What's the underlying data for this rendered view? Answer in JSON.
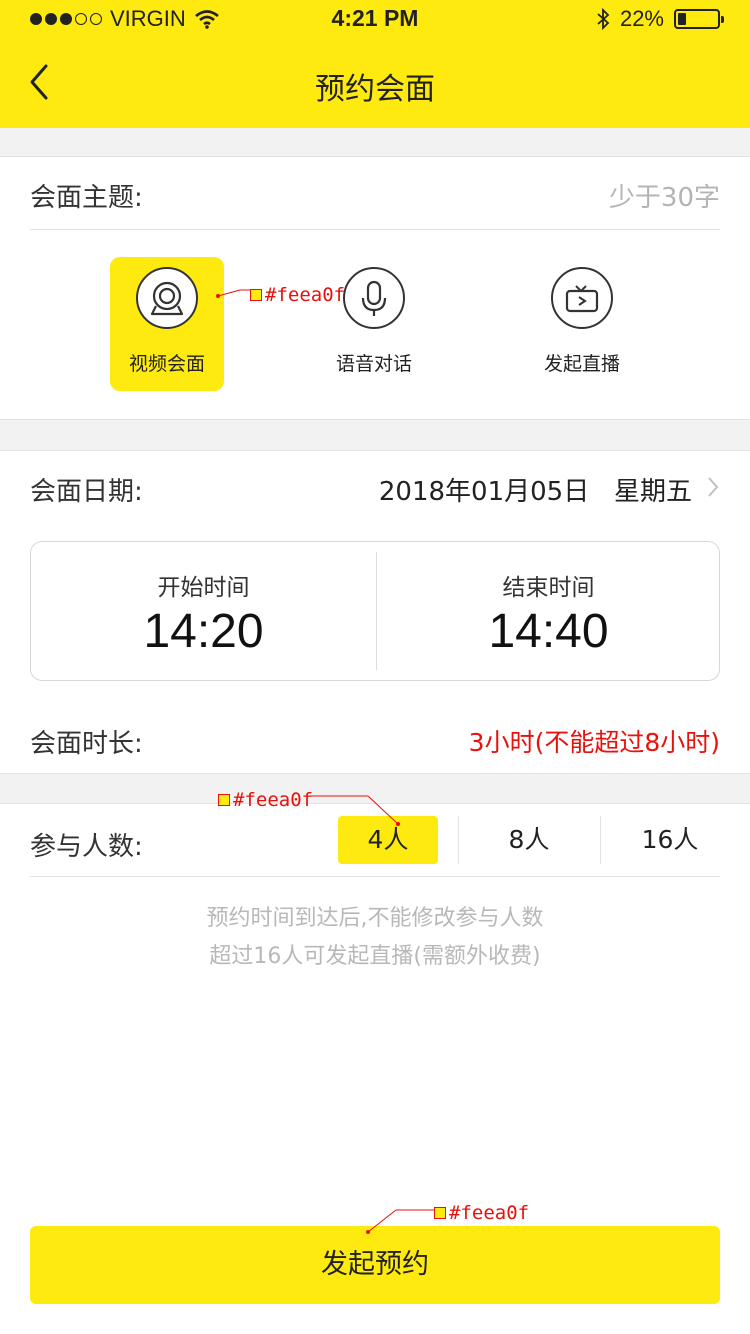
{
  "status_bar": {
    "carrier": "VIRGIN",
    "time": "4:21 PM",
    "battery": "22%",
    "battery_level": 0.22
  },
  "nav": {
    "title": "预约会面",
    "back_icon": "chevron-left-icon"
  },
  "topic": {
    "label": "会面主题:",
    "placeholder": "少于30字"
  },
  "modes": [
    {
      "label": "视频会面",
      "icon": "webcam-icon",
      "active": true
    },
    {
      "label": "语音对话",
      "icon": "microphone-icon",
      "active": false
    },
    {
      "label": "发起直播",
      "icon": "tv-play-icon",
      "active": false
    }
  ],
  "date": {
    "label": "会面日期:",
    "value": "2018年01月05日   星期五"
  },
  "time": {
    "start_label": "开始时间",
    "start_value": "14:20",
    "end_label": "结束时间",
    "end_value": "14:40"
  },
  "duration": {
    "label": "会面时长:",
    "value": "3小时(不能超过8小时)"
  },
  "people": {
    "label": "参与人数:",
    "options": [
      "4人",
      "8人",
      "16人"
    ],
    "selected": "4人"
  },
  "notes": [
    "预约时间到达后,不能修改参与人数",
    "超过16人可发起直播(需额外收费)"
  ],
  "submit_label": "发起预约",
  "annotations": [
    "#feea0f",
    "#feea0f",
    "#feea0f"
  ],
  "colors": {
    "accent": "#feea0f",
    "warning": "#e8110c",
    "hint": "#b8b8b8"
  }
}
